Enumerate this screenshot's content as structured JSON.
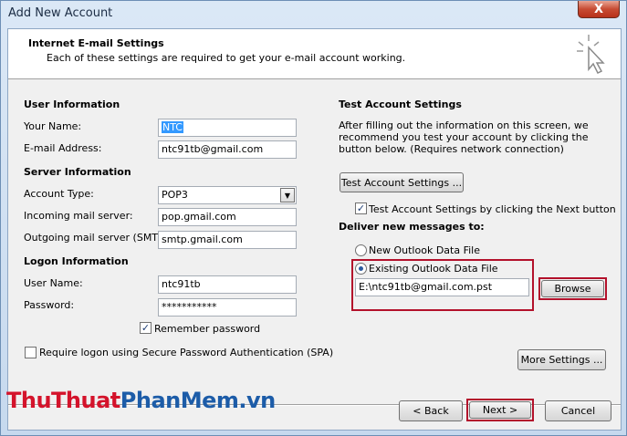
{
  "window": {
    "title": "Add New Account",
    "close_glyph": "X"
  },
  "header": {
    "title": "Internet E-mail Settings",
    "subtitle": "Each of these settings are required to get your e-mail account working.",
    "icon": "cursor-click-icon"
  },
  "user_info": {
    "section": "User Information",
    "name_label": "Your Name:",
    "name_value": "NTC",
    "email_label": "E-mail Address:",
    "email_value": "ntc91tb@gmail.com"
  },
  "server_info": {
    "section": "Server Information",
    "account_type_label": "Account Type:",
    "account_type_value": "POP3",
    "incoming_label": "Incoming mail server:",
    "incoming_value": "pop.gmail.com",
    "outgoing_label": "Outgoing mail server (SMTP):",
    "outgoing_value": "smtp.gmail.com"
  },
  "logon_info": {
    "section": "Logon Information",
    "user_label": "User Name:",
    "user_value": "ntc91tb",
    "password_label": "Password:",
    "password_value": "***********",
    "remember_label": "Remember password",
    "remember_checked": true,
    "spa_label": "Require logon using Secure Password Authentication (SPA)",
    "spa_checked": false
  },
  "test_settings": {
    "section": "Test Account Settings",
    "description": "After filling out the information on this screen, we recommend you test your account by clicking the button below. (Requires network connection)",
    "test_button": "Test Account Settings ...",
    "next_test_label": "Test Account Settings by clicking the Next button",
    "next_test_checked": true
  },
  "deliver": {
    "section": "Deliver new messages to:",
    "new_file_label": "New Outlook Data File",
    "existing_file_label": "Existing Outlook Data File",
    "selected": "existing",
    "path_value": "E:\\ntc91tb@gmail.com.pst",
    "browse_button": "Browse"
  },
  "more_settings_button": "More Settings ...",
  "nav": {
    "back": "< Back",
    "next": "Next >",
    "cancel": "Cancel"
  },
  "watermark": {
    "part1": "Thu",
    "part2": "Thuat",
    "part3": "Phan",
    "part4": "Mem",
    "part5": ".vn"
  },
  "colors": {
    "highlight": "#b3112b",
    "selection": "#3399ff"
  }
}
